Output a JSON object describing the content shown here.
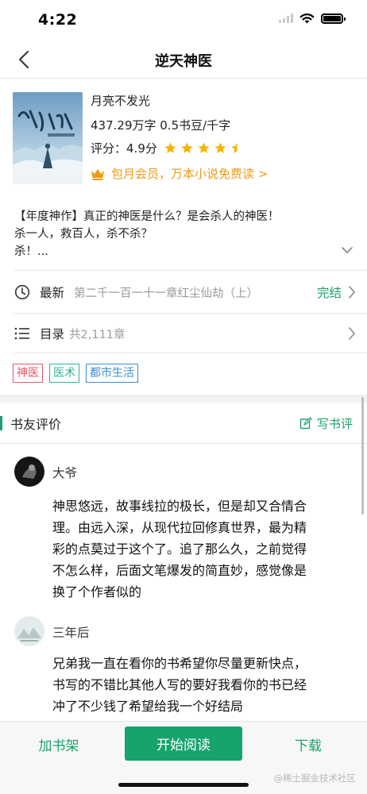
{
  "status_bar": {
    "time": "4:22"
  },
  "nav": {
    "title": "逆天神医"
  },
  "book": {
    "author": "月亮不发光",
    "meta": "437.29万字  0.5书豆/千字",
    "rating_label": "评分：",
    "rating_value": "4.9分",
    "stars": 4.5,
    "vip_text": "包月会员，万本小说免费读 >",
    "synopsis": [
      "【年度神作】真正的神医是什么？是会杀人的神医！",
      "杀一人，救百人，杀不杀？",
      "杀！..."
    ]
  },
  "latest": {
    "label": "最新",
    "chapter": "第二千一百一十一章红尘仙劫（上）",
    "status": "完结"
  },
  "toc": {
    "label": "目录",
    "count": "共2,111章"
  },
  "tags": [
    {
      "text": "神医",
      "color": "#e8566a"
    },
    {
      "text": "医术",
      "color": "#2bb59a"
    },
    {
      "text": "都市生活",
      "color": "#3a8ed6"
    }
  ],
  "reviews_section": {
    "title": "书友评价",
    "write_label": "写书评"
  },
  "reviews": [
    {
      "name": "大爷",
      "lines": [
        "神思悠远，故事线拉的极长，但是却又合情合",
        "理。由远入深，从现代拉回修真世界，最为精",
        "彩的点莫过于这个了。追了那么久，之前觉得",
        "不怎么样，后面文笔爆发的简直妙，感觉像是",
        "换了个作者似的"
      ]
    },
    {
      "name": "三年后",
      "lines": [
        "兄弟我一直在看你的书希望你尽量更新快点，",
        "书写的不错比其他人写的要好我看你的书已经",
        "冲了不少钱了希望给我一个好结局"
      ]
    }
  ],
  "bottom": {
    "shelf": "加书架",
    "read": "开始阅读",
    "download": "下载"
  },
  "watermark": "@稀土掘金技术社区",
  "colors": {
    "accent": "#1aa26b",
    "vip": "#ee9b14",
    "star": "#f5b400"
  }
}
